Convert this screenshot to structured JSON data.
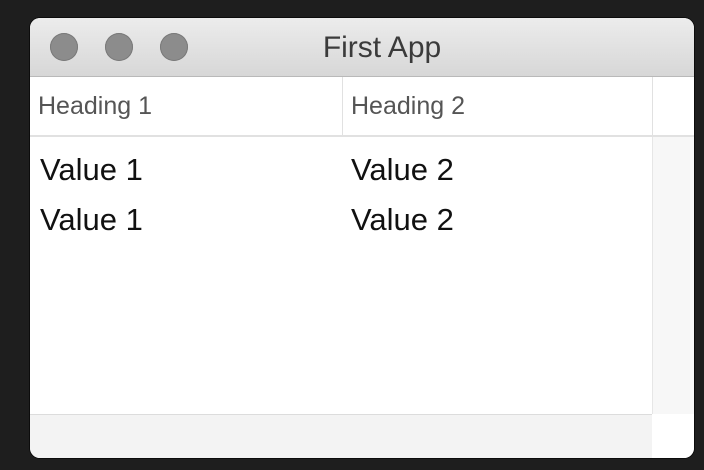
{
  "window": {
    "title": "First App"
  },
  "table": {
    "headers": [
      "Heading 1",
      "Heading 2"
    ],
    "rows": [
      [
        "Value 1",
        "Value 2"
      ],
      [
        "Value 1",
        "Value 2"
      ]
    ]
  },
  "colors": {
    "traffic_light": "#8c8c8c",
    "titlebar": "#e2e2e2",
    "backdrop": "#1e1e1e"
  }
}
